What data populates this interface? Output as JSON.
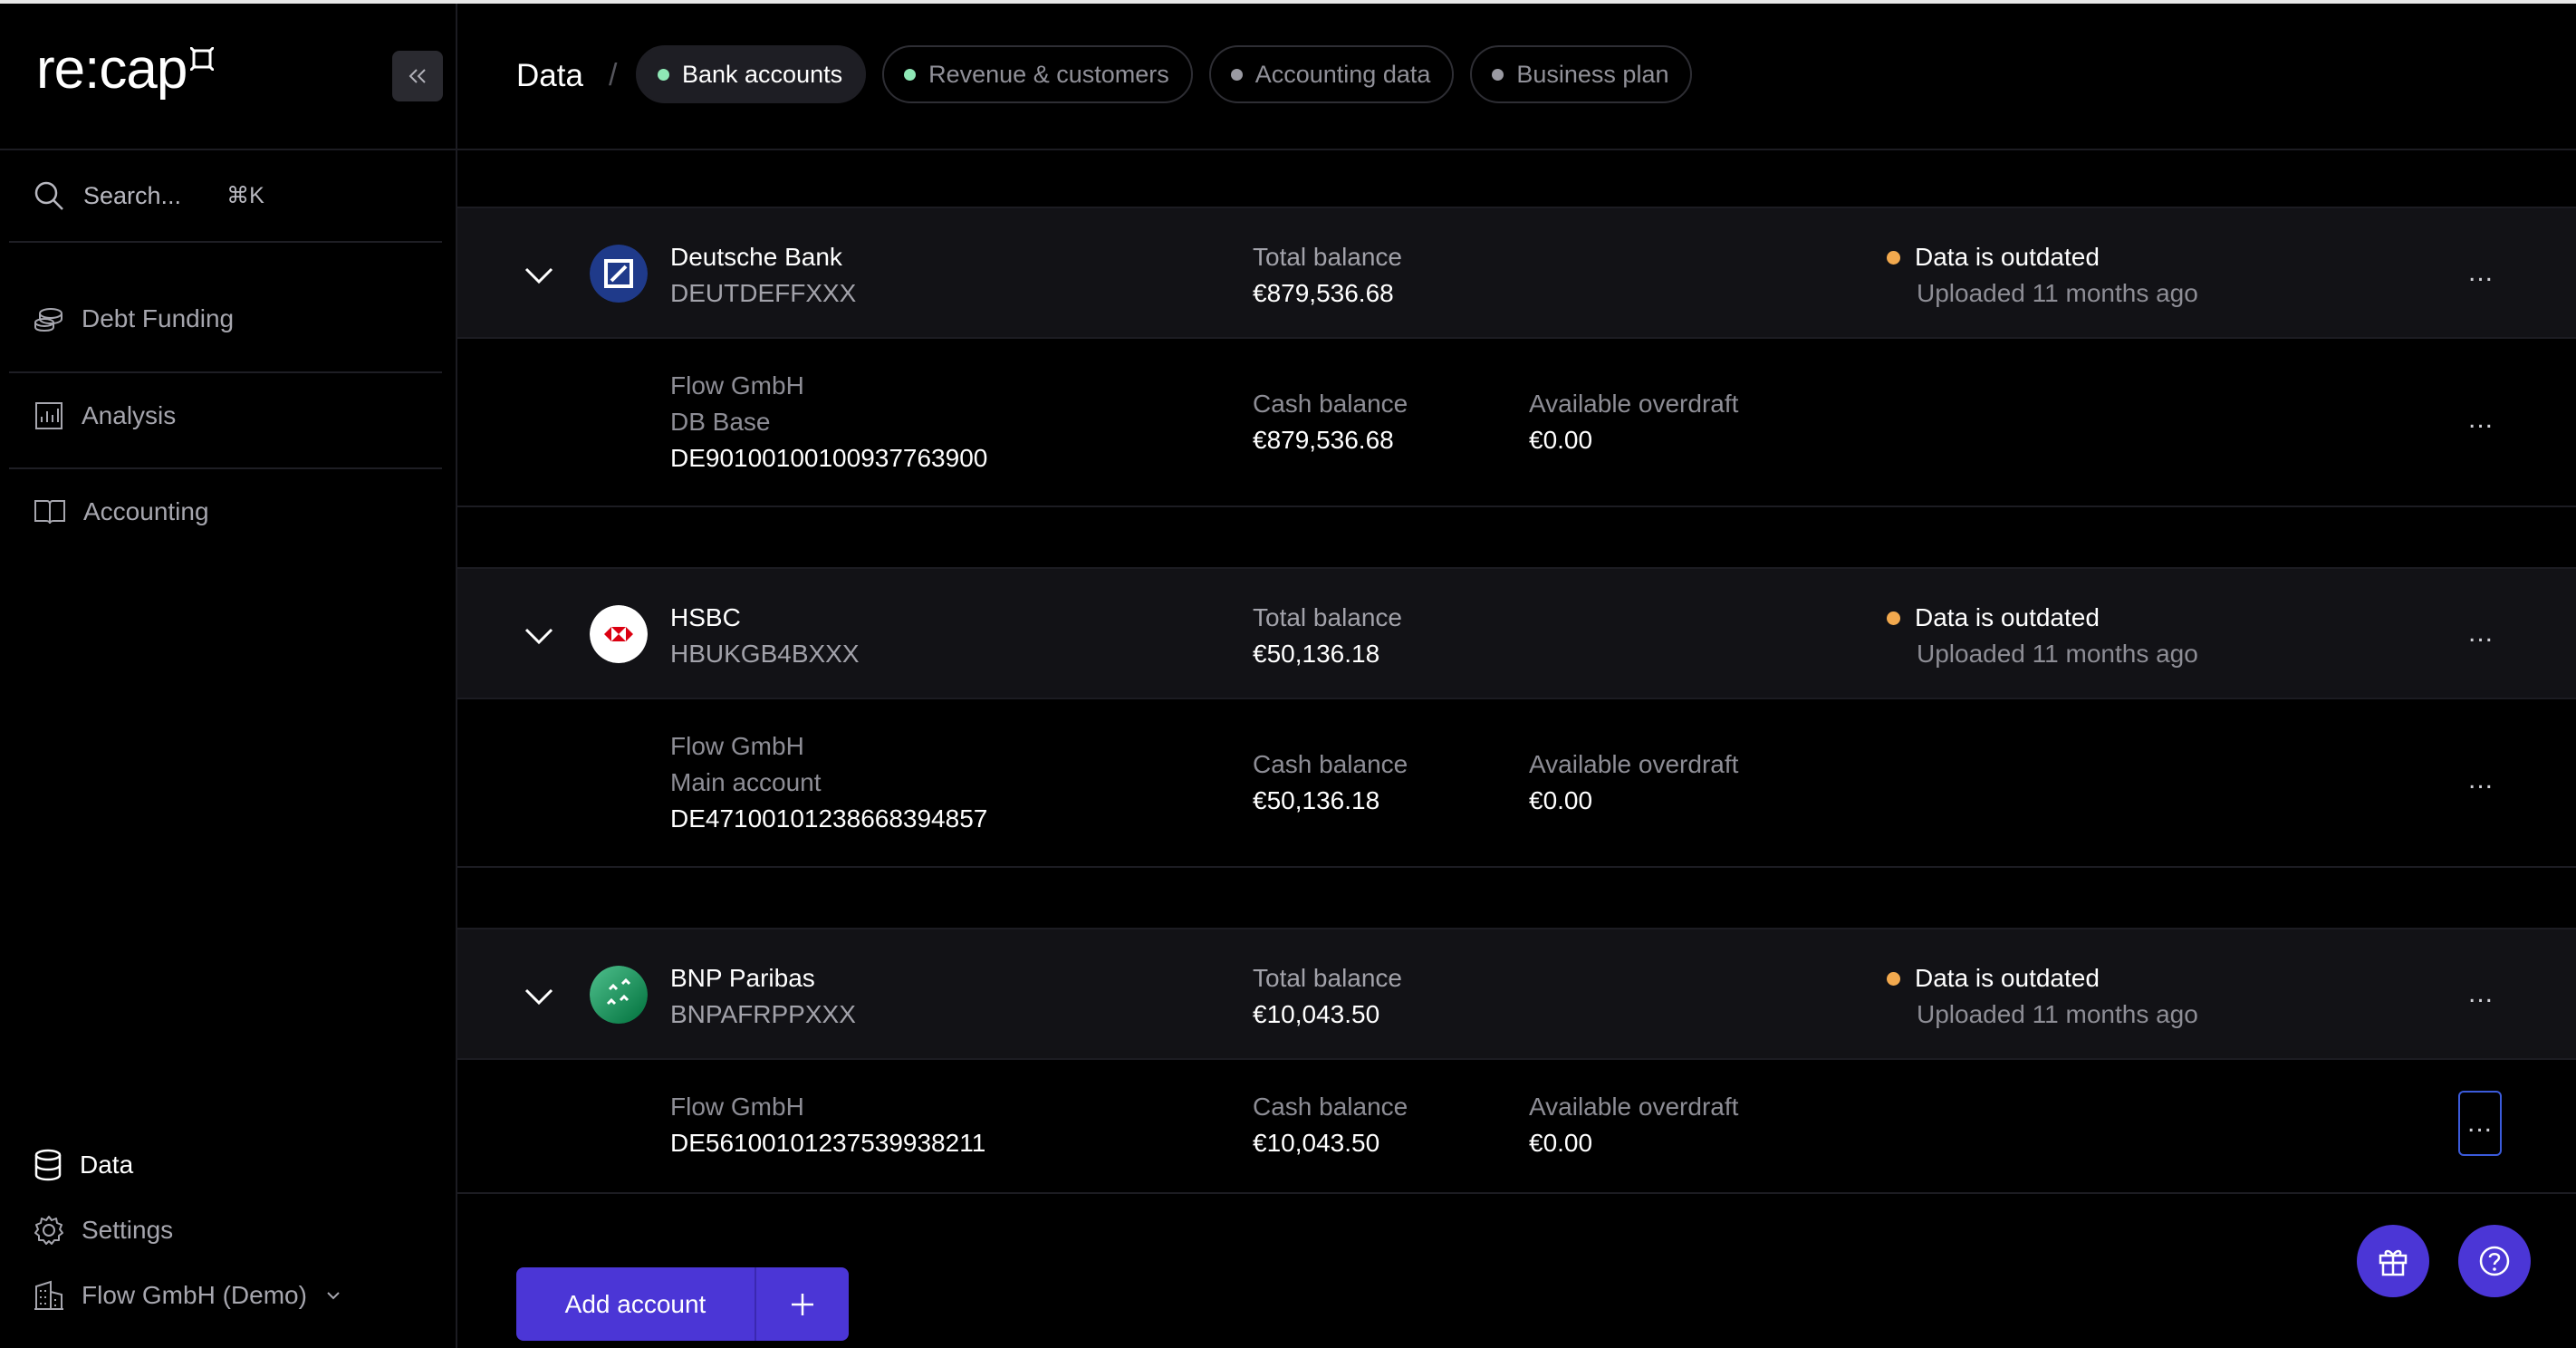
{
  "app": {
    "logo_text": "re:cap"
  },
  "sidebar": {
    "search_label": "Search...",
    "search_shortcut": "⌘K",
    "items": [
      {
        "label": "Debt Funding",
        "icon": "coins-icon"
      },
      {
        "label": "Analysis",
        "icon": "chart-icon"
      },
      {
        "label": "Accounting",
        "icon": "book-icon"
      }
    ],
    "bottom": [
      {
        "label": "Data",
        "icon": "database-icon",
        "active": true
      },
      {
        "label": "Settings",
        "icon": "gear-icon"
      },
      {
        "label": "Flow GmbH (Demo)",
        "icon": "building-icon"
      }
    ]
  },
  "header": {
    "breadcrumb": "Data",
    "separator": "/",
    "tabs": [
      {
        "label": "Bank accounts",
        "active": true,
        "dot_color": "#8fe8b6"
      },
      {
        "label": "Revenue & customers",
        "dot_color": "#8fe8b6"
      },
      {
        "label": "Accounting data",
        "dot_color": "#9a9aa2"
      },
      {
        "label": "Business plan",
        "dot_color": "#9a9aa2"
      }
    ]
  },
  "labels": {
    "total_balance": "Total balance",
    "cash_balance": "Cash balance",
    "available_overdraft": "Available overdraft",
    "status": "Data is outdated",
    "uploaded": "Uploaded 11 months ago",
    "more": "..."
  },
  "banks": [
    {
      "name": "Deutsche Bank",
      "bic": "DEUTDEFFXXX",
      "total_balance": "€879,536.68",
      "account": {
        "holder": "Flow GmbH",
        "product": "DB Base",
        "iban": "DE90100100100937763900",
        "cash_balance": "€879,536.68",
        "overdraft": "€0.00"
      }
    },
    {
      "name": "HSBC",
      "bic": "HBUKGB4BXXX",
      "total_balance": "€50,136.18",
      "account": {
        "holder": "Flow GmbH",
        "product": "Main account",
        "iban": "DE47100101238668394857",
        "cash_balance": "€50,136.18",
        "overdraft": "€0.00"
      }
    },
    {
      "name": "BNP Paribas",
      "bic": "BNPAFRPPXXX",
      "total_balance": "€10,043.50",
      "account": {
        "holder": "Flow GmbH",
        "iban": "DE56100101237539938211",
        "cash_balance": "€10,043.50",
        "overdraft": "€0.00"
      }
    }
  ],
  "footer": {
    "add_account_label": "Add account"
  },
  "colors": {
    "accent": "#4b36d6",
    "status_warning": "#f2a94e",
    "active_dot": "#8fe8b6"
  }
}
